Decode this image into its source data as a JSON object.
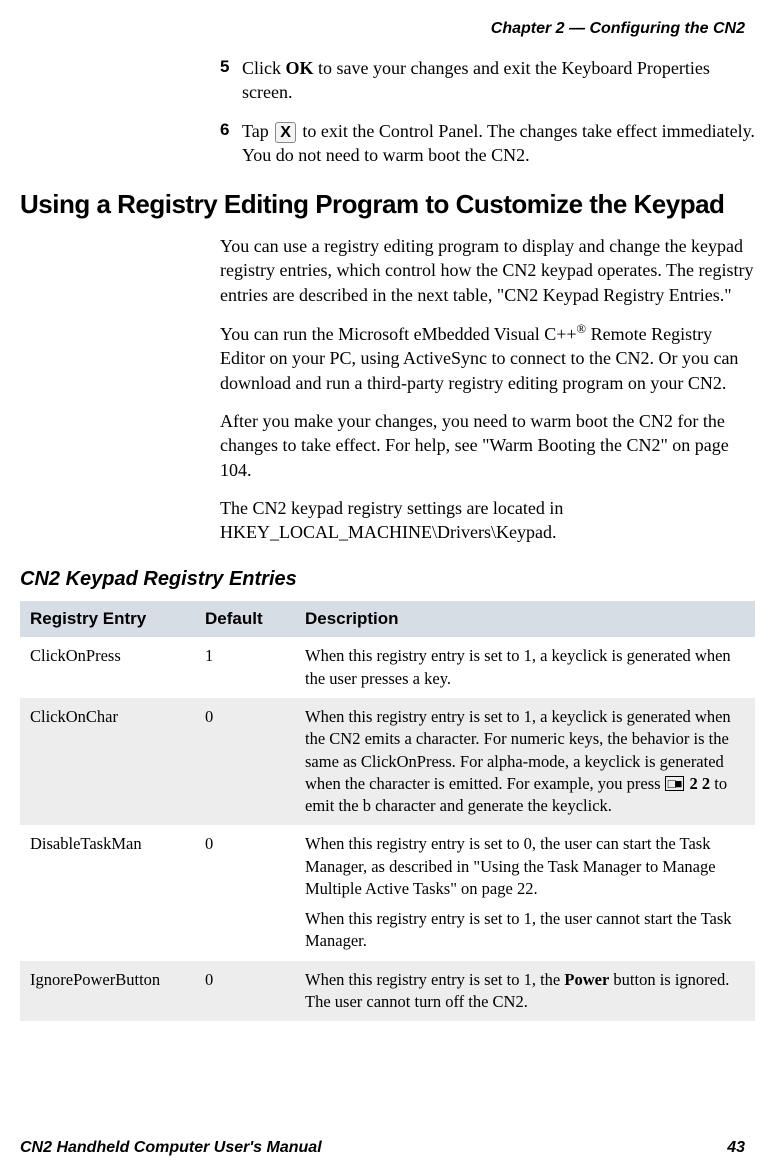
{
  "chapter_header": "Chapter 2 — Configuring the CN2",
  "steps": [
    {
      "num": "5",
      "segments": [
        {
          "t": "Click "
        },
        {
          "t": "OK",
          "bold": true
        },
        {
          "t": " to save your changes and exit the Keyboard Properties screen."
        }
      ]
    },
    {
      "num": "6",
      "segments": [
        {
          "t": "Tap "
        },
        {
          "t": "X",
          "xicon": true
        },
        {
          "t": " to exit the Control Panel. The changes take effect immediately. You do not need to warm boot the CN2."
        }
      ]
    }
  ],
  "h1": "Using a Registry Editing Program to Customize the Keypad",
  "paragraphs": [
    {
      "segments": [
        {
          "t": "You can use a registry editing program to display and change the keypad registry entries, which control how the CN2 keypad operates. The registry entries are described in the next table, \"CN2 Keypad Registry Entries.\""
        }
      ]
    },
    {
      "segments": [
        {
          "t": "You can run the Microsoft eMbedded Visual C++"
        },
        {
          "t": "®",
          "sup": true
        },
        {
          "t": " Remote Registry Editor on your PC, using ActiveSync to connect to the CN2. Or you can download and run a third-party registry editing program on your CN2."
        }
      ]
    },
    {
      "segments": [
        {
          "t": "After you make your changes, you need to warm boot the CN2 for the changes to take effect. For help, see \"Warm Booting the CN2\" on page 104."
        }
      ]
    },
    {
      "segments": [
        {
          "t": "The CN2 keypad registry settings are located in HKEY_LOCAL_MACHINE\\Drivers\\Keypad."
        }
      ]
    }
  ],
  "table_title": "CN2 Keypad Registry Entries",
  "table_headers": {
    "entry": "Registry Entry",
    "default": "Default",
    "desc": "Description"
  },
  "table_rows": [
    {
      "entry": "ClickOnPress",
      "default": "1",
      "desc_blocks": [
        {
          "segments": [
            {
              "t": "When this registry entry is set to 1, a keyclick is generated when the user presses a key."
            }
          ]
        }
      ]
    },
    {
      "entry": "ClickOnChar",
      "default": "0",
      "alt": true,
      "desc_blocks": [
        {
          "segments": [
            {
              "t": "When this registry entry is set to 1, a keyclick is generated when the CN2 emits a character. For numeric keys, the behavior is the same as ClickOnPress. For alpha-mode, a keyclick is generated when the character is emitted. For example, you press "
            },
            {
              "t": "□■",
              "keyicon": true
            },
            {
              "t": " "
            },
            {
              "t": "2 2",
              "bold": true
            },
            {
              "t": " to emit the b character and generate the keyclick."
            }
          ]
        }
      ]
    },
    {
      "entry": "DisableTaskMan",
      "default": "0",
      "desc_blocks": [
        {
          "segments": [
            {
              "t": "When this registry entry is set to 0, the user can start the Task Manager, as described in \"Using the Task Manager to Manage Multiple Active Tasks\" on page 22."
            }
          ]
        },
        {
          "segments": [
            {
              "t": "When this registry entry is set to 1, the user cannot start the Task Manager."
            }
          ]
        }
      ]
    },
    {
      "entry": "IgnorePowerButton",
      "default": "0",
      "alt": true,
      "desc_blocks": [
        {
          "segments": [
            {
              "t": "When this registry entry is set to 1, the "
            },
            {
              "t": "Power",
              "bold": true
            },
            {
              "t": " button is ignored. The user cannot turn off the CN2."
            }
          ]
        }
      ]
    }
  ],
  "footer": {
    "left": "CN2 Handheld Computer User's Manual",
    "right": "43"
  }
}
